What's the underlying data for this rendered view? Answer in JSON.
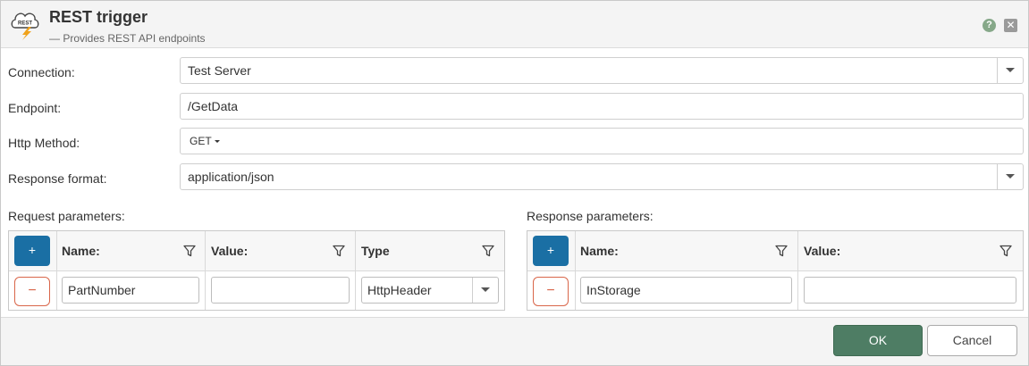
{
  "header": {
    "title": "REST trigger",
    "subtitle": "— Provides REST API endpoints",
    "logo_text": "REST",
    "help_label": "?",
    "close_label": "✕"
  },
  "form": {
    "connection": {
      "label": "Connection:",
      "value": "Test Server"
    },
    "endpoint": {
      "label": "Endpoint:",
      "value": "/GetData"
    },
    "http_method": {
      "label": "Http Method:",
      "value": "GET"
    },
    "response_format": {
      "label": "Response format:",
      "value": "application/json"
    }
  },
  "request_params": {
    "label": "Request parameters:",
    "add_label": "+",
    "delete_label": "−",
    "columns": [
      "Name:",
      "Value:",
      "Type"
    ],
    "row": {
      "name": "PartNumber",
      "value": "",
      "type": "HttpHeader"
    }
  },
  "response_params": {
    "label": "Response parameters:",
    "add_label": "+",
    "delete_label": "−",
    "columns": [
      "Name:",
      "Value:"
    ],
    "row": {
      "name": "InStorage",
      "value": ""
    }
  },
  "footer": {
    "ok_label": "OK",
    "cancel_label": "Cancel"
  },
  "colors": {
    "primary": "#1a6fa4",
    "ok": "#4e7d64",
    "danger": "#d9664a",
    "help": "#86a889"
  }
}
